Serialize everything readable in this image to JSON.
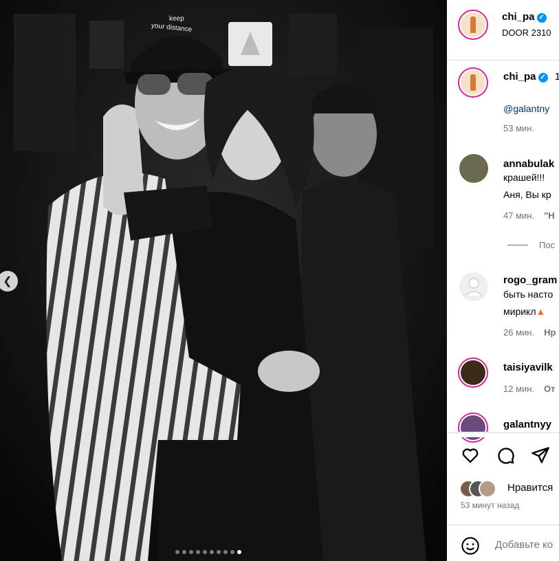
{
  "photo": {
    "hat_text_line1": "keep",
    "hat_text_line2": "your distance",
    "carousel_dot_count": 10,
    "active_dot_index": 9
  },
  "header": {
    "username": "chi_pa",
    "subtitle": "DOOR 2310"
  },
  "caption": {
    "username": "chi_pa",
    "after_name": "1",
    "mention": "@galantny",
    "time": "53 мин."
  },
  "comments": [
    {
      "username": "annabulak",
      "line1": "крашей!!!",
      "line2": "Аня, Вы кр",
      "time": "47 мин.",
      "action": "\"Н"
    },
    {
      "username": "rogo_gram",
      "line1": "быть насто",
      "line2": "мирикл",
      "time": "26 мин.",
      "action": "Нр"
    },
    {
      "username": "taisiyavilk",
      "time": "12 мин.",
      "action": "От"
    },
    {
      "username": "galantnyy"
    }
  ],
  "view_replies": "Пос",
  "actions": {
    "likes_text": "Нравится",
    "posted_ago": "53 минут назад",
    "comment_placeholder": "Добавьте ко"
  }
}
